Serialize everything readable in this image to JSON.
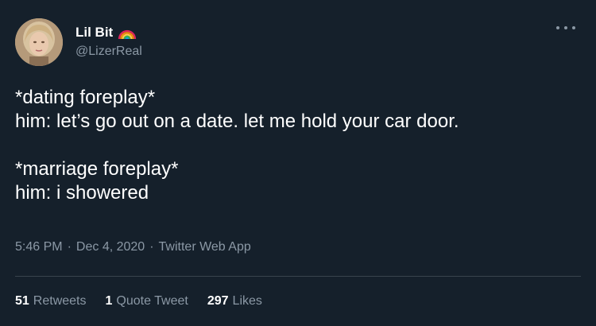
{
  "author": {
    "display_name": "Lil Bit",
    "handle": "@LizerReal",
    "avatar_icon": "profile-photo",
    "name_emoji_icon": "rainbow-icon"
  },
  "menu": {
    "more_icon": "more-horizontal-icon"
  },
  "tweet": {
    "lines": [
      "*dating foreplay*",
      "him: let’s go out on a date. let me hold your car door.",
      "*marriage foreplay*",
      "him: i showered"
    ]
  },
  "meta": {
    "time": "5:46 PM",
    "separator": "·",
    "date": "Dec 4, 2020",
    "source": "Twitter Web App"
  },
  "stats": {
    "retweets_count": "51",
    "retweets_label": "Retweets",
    "quotes_count": "1",
    "quotes_label": "Quote Tweet",
    "likes_count": "297",
    "likes_label": "Likes"
  },
  "colors": {
    "background": "#15202b",
    "text_primary": "#ffffff",
    "text_secondary": "#8b98a5",
    "divider": "#38444d"
  }
}
